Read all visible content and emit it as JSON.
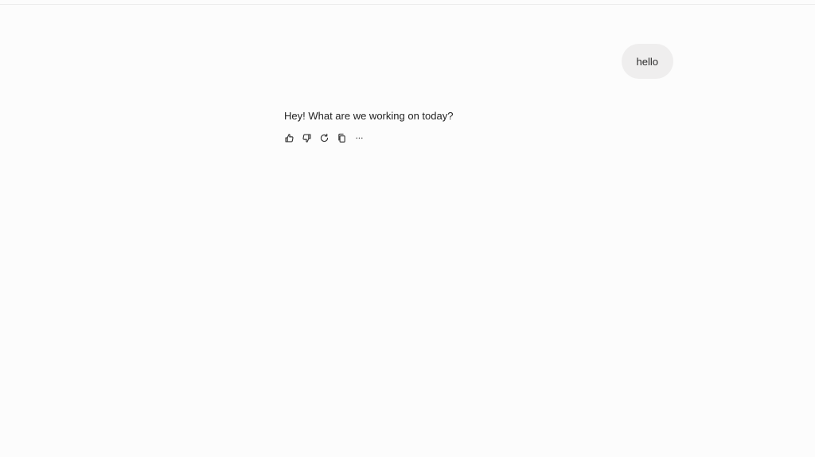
{
  "conversation": {
    "user_message": "hello",
    "assistant_message": "Hey! What are we working on today?"
  },
  "actions": [
    {
      "icon": "thumbs-up-icon"
    },
    {
      "icon": "thumbs-down-icon"
    },
    {
      "icon": "regenerate-icon"
    },
    {
      "icon": "copy-icon"
    },
    {
      "icon": "more-options-icon"
    }
  ],
  "colors": {
    "background": "#fcfcfc",
    "user_bubble": "#efeeee",
    "text": "#222222"
  }
}
